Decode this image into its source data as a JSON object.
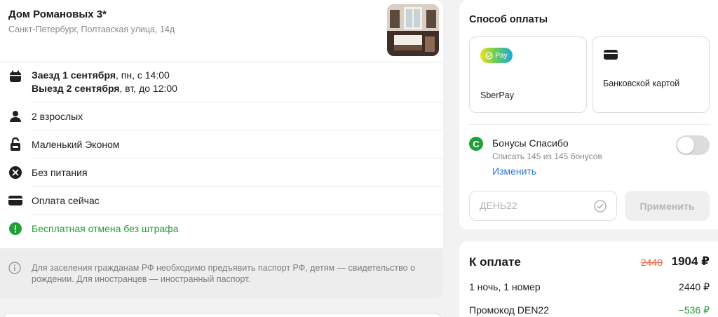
{
  "hotel": {
    "name": "Дом Романовых 3*",
    "address": "Санкт-Петербург, Полтавская улица, 14д"
  },
  "booking": {
    "checkin_bold": "Заезд 1 сентября",
    "checkin_rest": ", пн, с 14:00",
    "checkout_bold": "Выезд 2 сентября",
    "checkout_rest": ", вт, до 12:00",
    "guests": "2 взрослых",
    "room": "Маленький Эконом",
    "meal": "Без питания",
    "payment": "Оплата сейчас",
    "cancellation": "Бесплатная отмена без штрафа",
    "notice": "Для заселения гражданам РФ необходимо предъявить паспорт РФ, детям — свидетельство о рождении. Для иностранцев — иностранный паспорт."
  },
  "payment_method": {
    "title": "Способ оплаты",
    "sberpay_badge": "Pay",
    "options": [
      {
        "label": "SberPay"
      },
      {
        "label": "Банковской картой"
      }
    ]
  },
  "bonuses": {
    "title": "Бонусы Спасибо",
    "subtitle": "Списать 145 из 145 бонусов",
    "change_link": "Изменить",
    "logo_letter": "С"
  },
  "promo": {
    "placeholder": "ДЕНЬ22",
    "apply_label": "Применить"
  },
  "total": {
    "title": "К оплате",
    "old_price": "2440",
    "new_price": "1904 ₽",
    "lines": [
      {
        "label": "1 ночь, 1 номер",
        "value": "2440 ₽"
      },
      {
        "label": "Промокод DEN22",
        "value": "−536 ₽"
      }
    ]
  },
  "colors": {
    "accent_green": "#21a038",
    "link_blue": "#2b7bd6",
    "old_price_red": "#f0643c"
  }
}
